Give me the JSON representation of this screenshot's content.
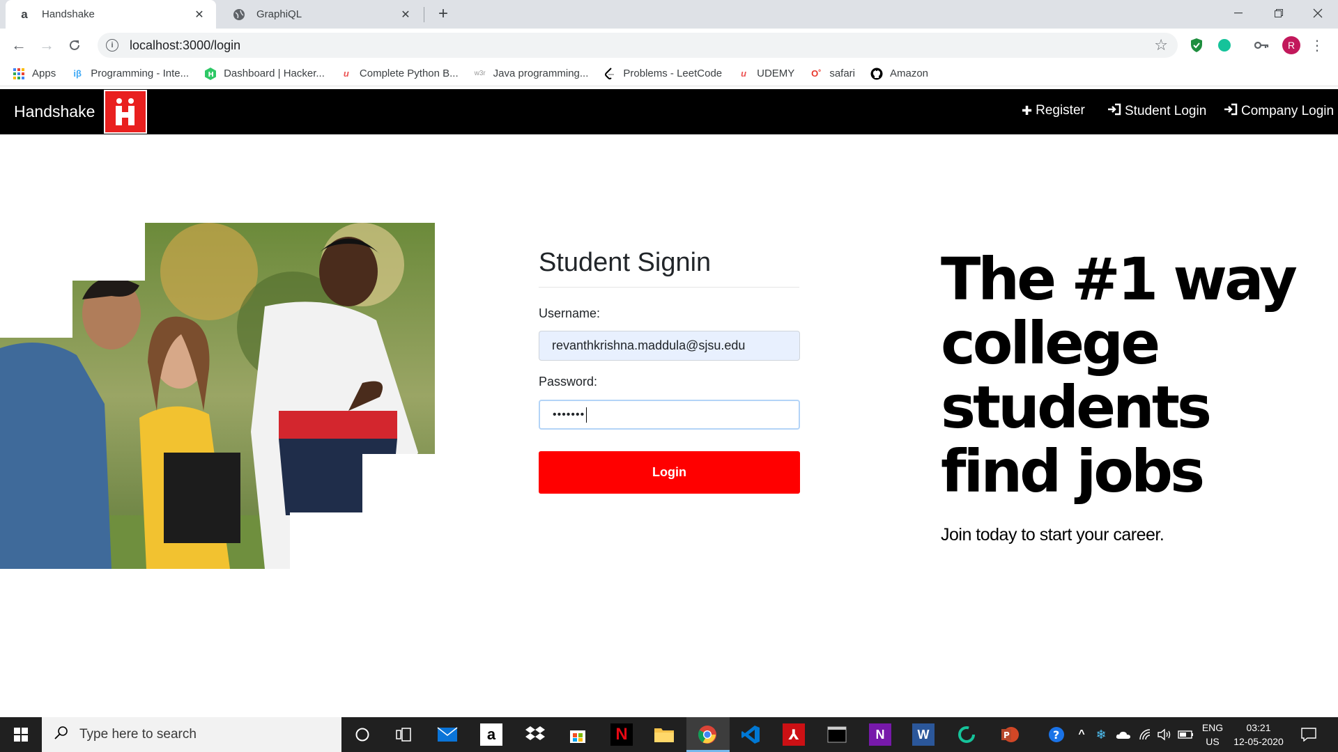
{
  "browser": {
    "tabs": [
      {
        "title": "Handshake",
        "favicon": "amazon-favicon",
        "active": true
      },
      {
        "title": "GraphiQL",
        "favicon": "globe-favicon",
        "active": false
      }
    ],
    "url": "localhost:3000/login",
    "profile_initial": "R",
    "bookmarks": [
      {
        "label": "Apps",
        "icon": "apps-grid-icon"
      },
      {
        "label": "Programming - Inte...",
        "icon": "interviewbit-icon"
      },
      {
        "label": "Dashboard | Hacker...",
        "icon": "hackerrank-icon"
      },
      {
        "label": "Complete Python B...",
        "icon": "udemy-icon"
      },
      {
        "label": "Java programming...",
        "icon": "w3r-icon"
      },
      {
        "label": "Problems - LeetCode",
        "icon": "leetcode-icon"
      },
      {
        "label": "UDEMY",
        "icon": "udemy-icon"
      },
      {
        "label": "safari",
        "icon": "safari-icon"
      },
      {
        "label": "Amazon",
        "icon": "github-icon"
      }
    ]
  },
  "navbar": {
    "brand": "Handshake",
    "links": [
      {
        "label": "Register",
        "icon": "plus-icon"
      },
      {
        "label": "Student Login",
        "icon": "sign-in-icon"
      },
      {
        "label": "Company Login",
        "icon": "sign-in-icon"
      }
    ]
  },
  "signin": {
    "title": "Student Signin",
    "username_label": "Username:",
    "username_value": "revanthkrishna.maddula@sjsu.edu",
    "password_label": "Password:",
    "password_masked": "•••••••",
    "login_label": "Login"
  },
  "hero": {
    "headline": [
      "The #1 way",
      "college",
      "students",
      "find jobs"
    ],
    "subline": "Join today to start your career."
  },
  "taskbar": {
    "search_placeholder": "Type here to search",
    "lang_top": "ENG",
    "lang_bottom": "US",
    "time": "03:21",
    "date": "12-05-2020"
  },
  "colors": {
    "brand_red": "#ff0000",
    "navbar_bg": "#000000",
    "logo_red": "#e9201f"
  }
}
